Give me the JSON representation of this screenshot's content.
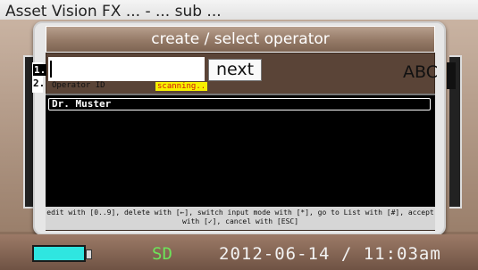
{
  "background_app": {
    "title": "Asset Vision FX   ... - ... sub ..."
  },
  "dialog": {
    "title": "create / select operator",
    "tabs": [
      "1.",
      "2."
    ],
    "input": {
      "value": "",
      "caption": "Operator ID",
      "status_badge": "scanning.."
    },
    "next_button": "next",
    "input_mode": "ABC",
    "list": [
      "Dr. Muster"
    ],
    "help_text": "edit with [0..9], delete with [←], switch input mode with [*], go to List with [#], accept with [✓], cancel with [ESC]"
  },
  "status_bar": {
    "battery_icon": "battery-icon",
    "battery_color": "#2fe6e0",
    "storage_label": "SD",
    "storage_color": "#6de45a",
    "datetime": "2012-06-14 / 11:03am"
  }
}
